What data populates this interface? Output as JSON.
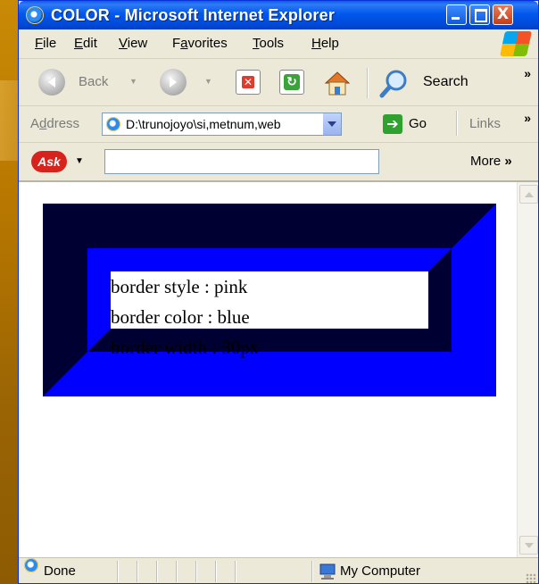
{
  "window": {
    "title": "COLOR - Microsoft Internet Explorer",
    "controls": {
      "minimize": "_",
      "maximize": "□",
      "close": "X"
    }
  },
  "menu": [
    {
      "accel": "F",
      "rest": "ile"
    },
    {
      "accel": "E",
      "rest": "dit"
    },
    {
      "accel": "V",
      "rest": "iew"
    },
    {
      "pre": "F",
      "accel": "a",
      "rest": "vorites"
    },
    {
      "accel": "T",
      "rest": "ools"
    },
    {
      "accel": "H",
      "rest": "elp"
    }
  ],
  "toolbar": {
    "back_label": "Back",
    "search_label": "Search",
    "chevron": "»"
  },
  "address": {
    "label_pre": "A",
    "label_accel": "d",
    "label_rest": "dress",
    "value": "D:\\trunojoyo\\si,metnum,web",
    "go_label": "Go",
    "links_label": "Links",
    "chevron": "»"
  },
  "askbar": {
    "logo": "Ask",
    "more_label": "More",
    "chevron": "»",
    "search_value": ""
  },
  "content": {
    "lines": [
      "border style : pink",
      "border color : blue",
      "border width : 30px"
    ]
  },
  "status": {
    "left_text": "Done",
    "zone_text": "My Computer"
  },
  "colors": {
    "border_dark": "#000033",
    "border_blue": "#0000ff",
    "titlebar": "#0058ee"
  },
  "icons": [
    "ie-icon",
    "minimize-icon",
    "maximize-icon",
    "close-icon",
    "windows-logo-icon",
    "back-arrow-icon",
    "forward-arrow-icon",
    "stop-icon",
    "refresh-icon",
    "home-icon",
    "search-icon",
    "go-arrow-icon",
    "ask-logo-icon",
    "my-computer-icon"
  ]
}
